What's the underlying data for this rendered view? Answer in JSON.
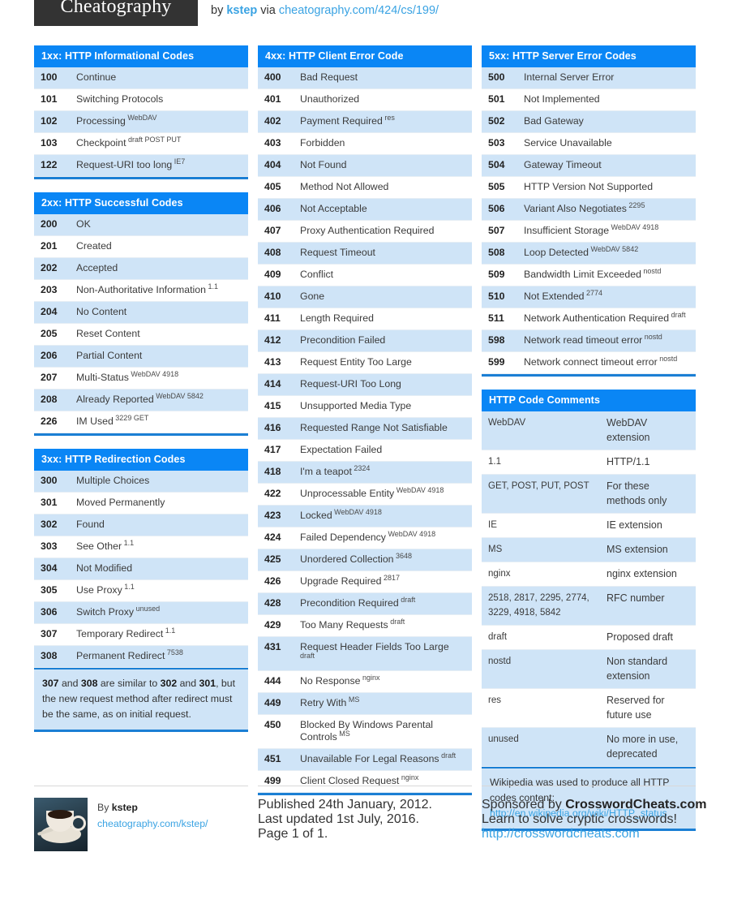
{
  "header": {
    "logo": "Cheatography",
    "by_prefix": "by",
    "author": "kstep",
    "via": "via",
    "url": "cheatography.com/424/cs/199/"
  },
  "tables": {
    "informational": {
      "title": "1xx: HTTP Informational Codes",
      "rows": [
        {
          "code": "100",
          "desc": "Continue",
          "sup": ""
        },
        {
          "code": "101",
          "desc": "Switching Protocols",
          "sup": ""
        },
        {
          "code": "102",
          "desc": "Processing",
          "sup": "WebDAV"
        },
        {
          "code": "103",
          "desc": "Checkpoint",
          "sup": "draft POST PUT"
        },
        {
          "code": "122",
          "desc": "Request-URI too long",
          "sup": "IE7"
        }
      ]
    },
    "successful": {
      "title": "2xx: HTTP Successful Codes",
      "rows": [
        {
          "code": "200",
          "desc": "OK",
          "sup": ""
        },
        {
          "code": "201",
          "desc": "Created",
          "sup": ""
        },
        {
          "code": "202",
          "desc": "Accepted",
          "sup": ""
        },
        {
          "code": "203",
          "desc": "Non-Authoritative Information",
          "sup": "1.1"
        },
        {
          "code": "204",
          "desc": "No Content",
          "sup": ""
        },
        {
          "code": "205",
          "desc": "Reset Content",
          "sup": ""
        },
        {
          "code": "206",
          "desc": "Partial Content",
          "sup": ""
        },
        {
          "code": "207",
          "desc": "Multi-Status",
          "sup": "WebDAV 4918"
        },
        {
          "code": "208",
          "desc": "Already Reported",
          "sup": "WebDAV 5842"
        },
        {
          "code": "226",
          "desc": "IM Used",
          "sup": "3229 GET"
        }
      ]
    },
    "redirection": {
      "title": "3xx: HTTP Redirection Codes",
      "rows": [
        {
          "code": "300",
          "desc": "Multiple Choices",
          "sup": ""
        },
        {
          "code": "301",
          "desc": "Moved Permanently",
          "sup": ""
        },
        {
          "code": "302",
          "desc": "Found",
          "sup": ""
        },
        {
          "code": "303",
          "desc": "See Other",
          "sup": "1.1"
        },
        {
          "code": "304",
          "desc": "Not Modified",
          "sup": ""
        },
        {
          "code": "305",
          "desc": "Use Proxy",
          "sup": "1.1"
        },
        {
          "code": "306",
          "desc": "Switch Proxy",
          "sup": "unused"
        },
        {
          "code": "307",
          "desc": "Temporary Redirect",
          "sup": "1.1"
        },
        {
          "code": "308",
          "desc": "Permanent Redirect",
          "sup": "7538"
        }
      ],
      "note_parts": [
        {
          "t": "307",
          "b": true
        },
        {
          "t": " and ",
          "b": false
        },
        {
          "t": "308",
          "b": true
        },
        {
          "t": " are similar to ",
          "b": false
        },
        {
          "t": "302",
          "b": true
        },
        {
          "t": " and ",
          "b": false
        },
        {
          "t": "301",
          "b": true
        },
        {
          "t": ", but the new request method after redirect must be the same, as on initial request.",
          "b": false
        }
      ]
    },
    "client_error": {
      "title": "4xx: HTTP Client Error Code",
      "rows": [
        {
          "code": "400",
          "desc": "Bad Request",
          "sup": ""
        },
        {
          "code": "401",
          "desc": "Unauthorized",
          "sup": ""
        },
        {
          "code": "402",
          "desc": "Payment Required",
          "sup": "res"
        },
        {
          "code": "403",
          "desc": "Forbidden",
          "sup": ""
        },
        {
          "code": "404",
          "desc": "Not Found",
          "sup": ""
        },
        {
          "code": "405",
          "desc": "Method Not Allowed",
          "sup": ""
        },
        {
          "code": "406",
          "desc": "Not Acceptable",
          "sup": ""
        },
        {
          "code": "407",
          "desc": "Proxy Authentication Required",
          "sup": ""
        },
        {
          "code": "408",
          "desc": "Request Timeout",
          "sup": ""
        },
        {
          "code": "409",
          "desc": "Conflict",
          "sup": ""
        },
        {
          "code": "410",
          "desc": "Gone",
          "sup": ""
        },
        {
          "code": "411",
          "desc": "Length Required",
          "sup": ""
        },
        {
          "code": "412",
          "desc": "Precondition Failed",
          "sup": ""
        },
        {
          "code": "413",
          "desc": "Request Entity Too Large",
          "sup": ""
        },
        {
          "code": "414",
          "desc": "Request-URI Too Long",
          "sup": ""
        },
        {
          "code": "415",
          "desc": "Unsupported Media Type",
          "sup": ""
        },
        {
          "code": "416",
          "desc": "Requested Range Not Satisfiable",
          "sup": ""
        },
        {
          "code": "417",
          "desc": "Expectation Failed",
          "sup": ""
        },
        {
          "code": "418",
          "desc": "I'm a teapot",
          "sup": "2324"
        },
        {
          "code": "422",
          "desc": "Unprocessable Entity",
          "sup": "WebDAV 4918"
        },
        {
          "code": "423",
          "desc": "Locked",
          "sup": "WebDAV 4918"
        },
        {
          "code": "424",
          "desc": "Failed Dependency",
          "sup": "WebDAV 4918"
        },
        {
          "code": "425",
          "desc": "Unordered Collection",
          "sup": "3648"
        },
        {
          "code": "426",
          "desc": "Upgrade Required",
          "sup": "2817"
        },
        {
          "code": "428",
          "desc": "Precondition Required",
          "sup": "draft"
        },
        {
          "code": "429",
          "desc": "Too Many Requests",
          "sup": "draft"
        },
        {
          "code": "431",
          "desc": "Request Header Fields Too Large",
          "sup": "draft"
        },
        {
          "code": "444",
          "desc": "No Response",
          "sup": "nginx"
        },
        {
          "code": "449",
          "desc": "Retry With",
          "sup": "MS"
        },
        {
          "code": "450",
          "desc": "Blocked By Windows Parental Controls",
          "sup": "MS"
        },
        {
          "code": "451",
          "desc": "Unavailable For Legal Reasons",
          "sup": "draft"
        },
        {
          "code": "499",
          "desc": "Client Closed Request",
          "sup": "nginx"
        }
      ]
    },
    "server_error": {
      "title": "5xx: HTTP Server Error Codes",
      "rows": [
        {
          "code": "500",
          "desc": "Internal Server Error",
          "sup": ""
        },
        {
          "code": "501",
          "desc": "Not Implemented",
          "sup": ""
        },
        {
          "code": "502",
          "desc": "Bad Gateway",
          "sup": ""
        },
        {
          "code": "503",
          "desc": "Service Unavailable",
          "sup": ""
        },
        {
          "code": "504",
          "desc": "Gateway Timeout",
          "sup": ""
        },
        {
          "code": "505",
          "desc": "HTTP Version Not Supported",
          "sup": ""
        },
        {
          "code": "506",
          "desc": "Variant Also Negotiates",
          "sup": "2295"
        },
        {
          "code": "507",
          "desc": "Insufficient Storage",
          "sup": "WebDAV 4918"
        },
        {
          "code": "508",
          "desc": "Loop Detected",
          "sup": "WebDAV 5842"
        },
        {
          "code": "509",
          "desc": "Bandwidth Limit Exceeded",
          "sup": "nostd"
        },
        {
          "code": "510",
          "desc": "Not Extended",
          "sup": "2774"
        },
        {
          "code": "511",
          "desc": "Network Authentication Required",
          "sup": "draft"
        },
        {
          "code": "598",
          "desc": "Network read timeout error",
          "sup": "nostd"
        },
        {
          "code": "599",
          "desc": "Network connect timeout error",
          "sup": "nostd"
        }
      ]
    },
    "comments": {
      "title": "HTTP Code Comments",
      "rows": [
        {
          "k": "WebDAV",
          "v": "WebDAV extension"
        },
        {
          "k": "1.1",
          "v": "HTTP/1.1"
        },
        {
          "k": "GET, POST, PUT, POST",
          "v": "For these methods only"
        },
        {
          "k": "IE",
          "v": "IE extension"
        },
        {
          "k": "MS",
          "v": "MS extension"
        },
        {
          "k": "nginx",
          "v": "nginx extension"
        },
        {
          "k": "2518, 2817, 2295, 2774, 3229, 4918, 5842",
          "v": "RFC number"
        },
        {
          "k": "draft",
          "v": "Proposed draft"
        },
        {
          "k": "nostd",
          "v": "Non standard extension"
        },
        {
          "k": "res",
          "v": "Reserved for future use"
        },
        {
          "k": "unused",
          "v": "No more in use, deprecated"
        }
      ],
      "wiki_text": "Wikipedia was used to produce all HTTP codes content:",
      "wiki_link": "http://en.wikipedia.org/wiki/HTTP_status"
    }
  },
  "footer": {
    "author_prefix": "By",
    "author": "kstep",
    "author_url": "cheatography.com/kstep/",
    "published": "Published 24th January, 2012.",
    "updated": "Last updated 1st July, 2016.",
    "page": "Page 1 of 1.",
    "sponsor_prefix": "Sponsored by",
    "sponsor": "CrosswordCheats.com",
    "sponsor_tagline": "Learn to solve cryptic crosswords!",
    "sponsor_url": "http://crosswordcheats.com"
  },
  "colors": {
    "header_blue": "#0a86f5",
    "row_alt": "#cfe4f7",
    "rule_blue": "#1b7fd4",
    "link": "#3aa3e3",
    "logo_bg": "#333333"
  }
}
